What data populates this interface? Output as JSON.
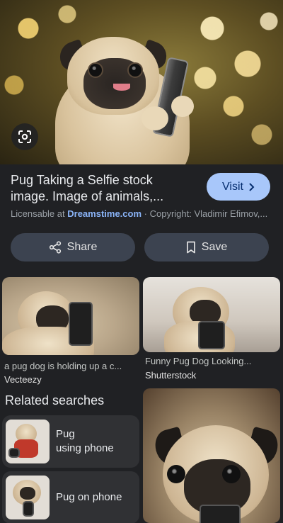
{
  "hero": {
    "lens_icon": "google-lens-icon"
  },
  "details": {
    "title_line1": "Pug Taking a Selfie stock",
    "title_line2": "image. Image of animals,...",
    "visit_label": "Visit",
    "visit_icon": "chevron-right-icon",
    "licensable_prefix": "Licensable at",
    "site_name": "Dreamstime.com",
    "copyright": "· Copyright: Vladimir Efimov,..."
  },
  "actions": {
    "share_label": "Share",
    "share_icon": "share-icon",
    "save_label": "Save",
    "save_icon": "bookmark-icon"
  },
  "results": [
    {
      "caption": "a pug dog is holding up a c...",
      "source": "Vecteezy"
    },
    {
      "caption": "Funny Pug Dog Looking...",
      "source": "Shutterstock"
    }
  ],
  "related": {
    "heading": "Related searches",
    "items": [
      {
        "label_line1": "Pug",
        "label_line2": "using phone"
      },
      {
        "label_line1": "Pug on phone",
        "label_line2": ""
      }
    ]
  },
  "colors": {
    "background": "#202124",
    "visit_button": "#a8c7fa",
    "pill_button": "#3c4350",
    "link": "#8ab4f8"
  }
}
